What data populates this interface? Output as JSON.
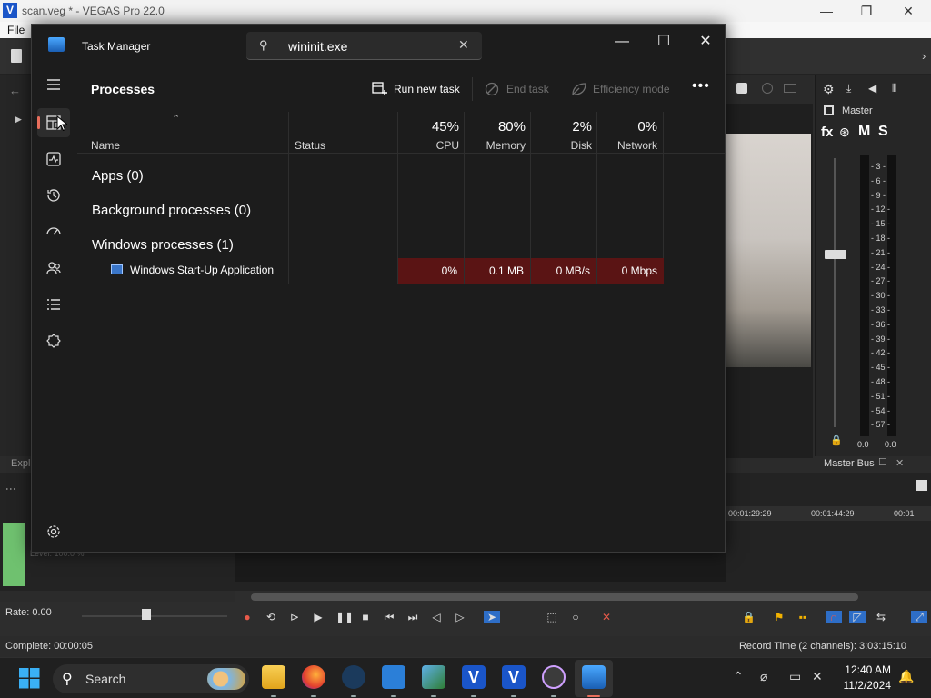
{
  "vegas": {
    "window_title": "scan.veg * - VEGAS Pro 22.0",
    "app_letter": "V",
    "menu_file": "File",
    "explorer_tab": "Expl",
    "master_label": "Master",
    "master_fx": "fx",
    "master_m": "M",
    "master_s": "S",
    "db_marks": [
      "3",
      "6",
      "9",
      "12",
      "15",
      "18",
      "21",
      "24",
      "27",
      "30",
      "33",
      "36",
      "39",
      "42",
      "45",
      "48",
      "51",
      "54",
      "57"
    ],
    "meter_left": "0.0",
    "meter_right": "0.0",
    "master_bus": "Master Bus",
    "ruler_marks": [
      "00:01:29:29",
      "00:01:44:29",
      "00:01"
    ],
    "level_text": "Level: 100.0 %",
    "rate": "Rate: 0.00",
    "status_left": "Complete: 00:00:05",
    "status_right": "Record Time (2 channels): 3:03:15:10"
  },
  "task_manager": {
    "title": "Task Manager",
    "search": {
      "value": "wininit.exe"
    },
    "heading": "Processes",
    "commands": {
      "run_new_task": "Run new task",
      "end_task": "End task",
      "efficiency_mode": "Efficiency mode"
    },
    "columns": {
      "name": "Name",
      "status": "Status",
      "cpu": {
        "label": "CPU",
        "percent": "45%"
      },
      "memory": {
        "label": "Memory",
        "percent": "80%"
      },
      "disk": {
        "label": "Disk",
        "percent": "2%"
      },
      "network": {
        "label": "Network",
        "percent": "0%"
      }
    },
    "groups": {
      "apps": "Apps (0)",
      "background": "Background processes (0)",
      "windows": "Windows processes (1)"
    },
    "process": {
      "name": "Windows Start-Up Application",
      "cpu": "0%",
      "memory": "0.1 MB",
      "disk": "0 MB/s",
      "network": "0 Mbps"
    }
  },
  "taskbar": {
    "search_label": "Search",
    "time": "12:40 AM",
    "date": "11/2/2024"
  },
  "colors": {
    "accent": "#e86e5c",
    "heat": "#5a1414",
    "vegas_blue": "#1a55c8"
  }
}
